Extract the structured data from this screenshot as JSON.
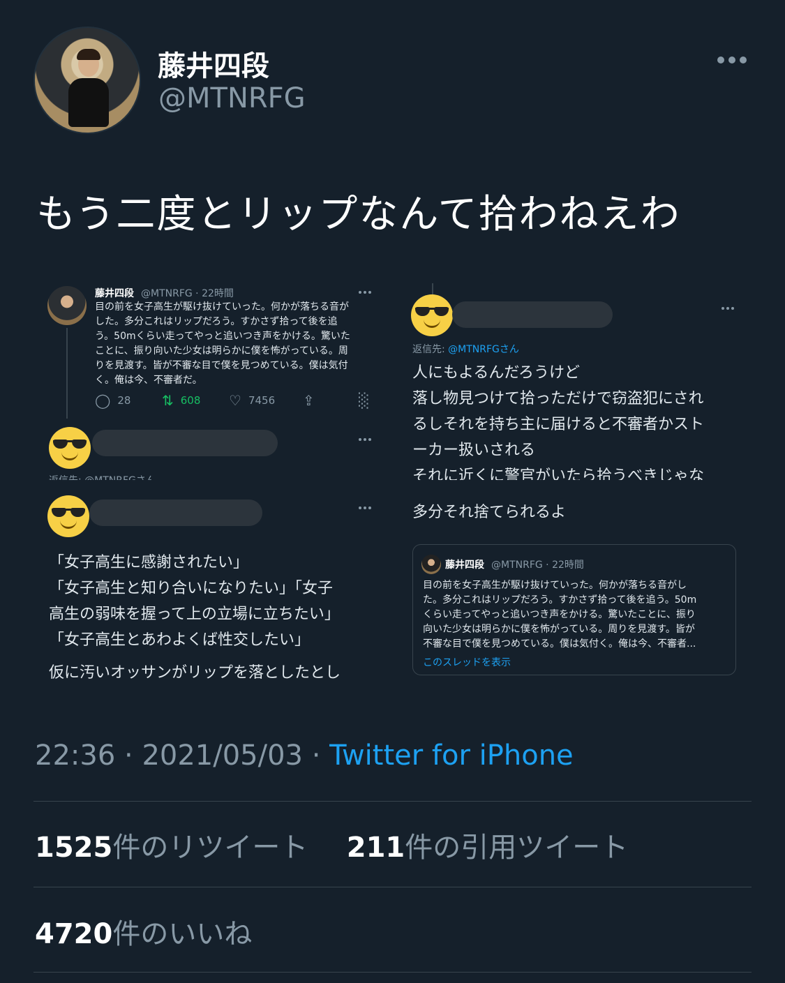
{
  "author": {
    "display_name": "藤井四段",
    "handle": "@MTNRFG"
  },
  "tweet": {
    "text": "もう二度とリップなんて拾わねえわ",
    "timestamp_time": "22:36",
    "timestamp_date": "2021/05/03",
    "source": "Twitter for iPhone",
    "retweets_count": "1525",
    "retweets_label": "件のリツイート",
    "quotes_count": "211",
    "quotes_label": "件の引用ツイート",
    "likes_count": "4720",
    "likes_label": "件のいいね"
  },
  "image1": {
    "name": "藤井四段",
    "meta": "@MTNRFG · 22時間",
    "lines": [
      "目の前を女子高生が駆け抜けていった。何かが落ちる音が",
      "した。多分これはリップだろう。すかさず拾って後を追",
      "う。50mくらい走ってやっと追いつき声をかける。驚いた",
      "ことに、振り向いた少女は明らかに僕を怖がっている。周",
      "りを見渡す。皆が不審な目で僕を見つめている。僕は気付",
      "く。俺は今、不審者だ。"
    ],
    "replies": "28",
    "retweets": "608",
    "likes": "7456",
    "reply_to": "返信先: @MTNRFGさん"
  },
  "image2": {
    "reply_prefix": "返信先: ",
    "reply_handle": "@MTNRFGさん",
    "lines": [
      "人にもよるんだろうけど",
      "落し物見つけて拾っただけで窃盗犯にされ",
      "るしそれを持ち主に届けると不審者かスト",
      "ーカー扱いされる",
      "それに近くに警官がいたら拾うべきじゃな"
    ]
  },
  "image3": {
    "lines": [
      "「女子高生に感謝されたい」",
      "「女子高生と知り合いになりたい」「女子",
      "高生の弱味を握って上の立場に立ちたい」",
      "「女子高生とあわよくば性交したい」",
      "仮に汚いオッサンがリップを落としたとし"
    ]
  },
  "image4": {
    "text": "多分それ捨てられるよ",
    "quote_name": "藤井四段",
    "quote_meta": "@MTNRFG · 22時間",
    "quote_lines": [
      "目の前を女子高生が駆け抜けていった。何かが落ちる音がし",
      "た。多分これはリップだろう。すかさず拾って後を追う。50m",
      "くらい走ってやっと追いつき声をかける。驚いたことに、振り",
      "向いた少女は明らかに僕を怖がっている。周りを見渡す。皆が",
      "不審な目で僕を見つめている。僕は気付く。俺は今、不審者..."
    ],
    "show_thread": "このスレッドを表示"
  }
}
